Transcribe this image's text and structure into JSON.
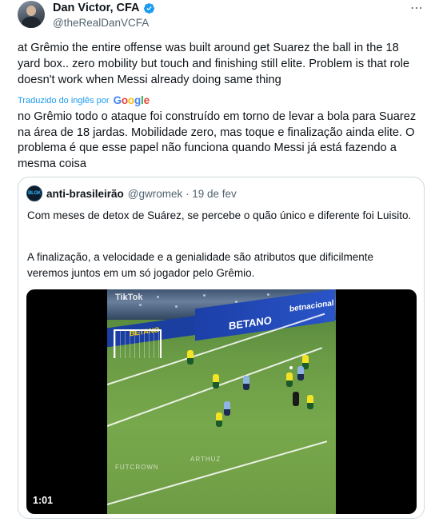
{
  "tweet": {
    "author_name": "Dan Victor, CFA",
    "author_handle": "@theRealDanVCFA",
    "more_icon": "⋯",
    "text": "at Grêmio the entire offense was built around get Suarez the ball in the 18 yard box.. zero mobility but touch and finishing still elite. Problem is that role doesn't work when Messi already doing same thing",
    "translated_label": "Traduzido do inglês por",
    "translation": "no Grêmio todo o ataque foi construído em torno de levar a bola para Suarez na área de 18 jardas. Mobilidade zero, mas toque e finalização ainda elite. O problema é que esse papel não funciona quando Messi já está fazendo a mesma coisa"
  },
  "google_logo": [
    "G",
    "o",
    "o",
    "g",
    "l",
    "e"
  ],
  "quote": {
    "avatar_text": "BLGK",
    "author_name": "anti-brasileirão",
    "meta": "@gwromek · 19 de fev",
    "paragraph1": "Com meses de detox de Suárez, se percebe o quão único e diferente foi Luisito.",
    "paragraph2": "A finalização, a velocidade e a genialidade são atributos que dificilmente veremos juntos em um só jogador pelo Grêmio."
  },
  "video": {
    "duration": "1:01",
    "watermark_tiktok": "TikTok",
    "ad_board_1": "BETANO",
    "ad_board_2": "betnacional",
    "ad_board_3": "BETANO",
    "watermark_1": "ARTHUZ",
    "watermark_2": "FUTCROWN"
  },
  "colors": {
    "verified": "#1d9bf0",
    "link": "#1d9bf0",
    "muted": "#536471",
    "border": "#cfd9de"
  },
  "icons": {
    "verified": "verified-badge-icon",
    "more": "more-options-icon",
    "google": "google-logo"
  }
}
